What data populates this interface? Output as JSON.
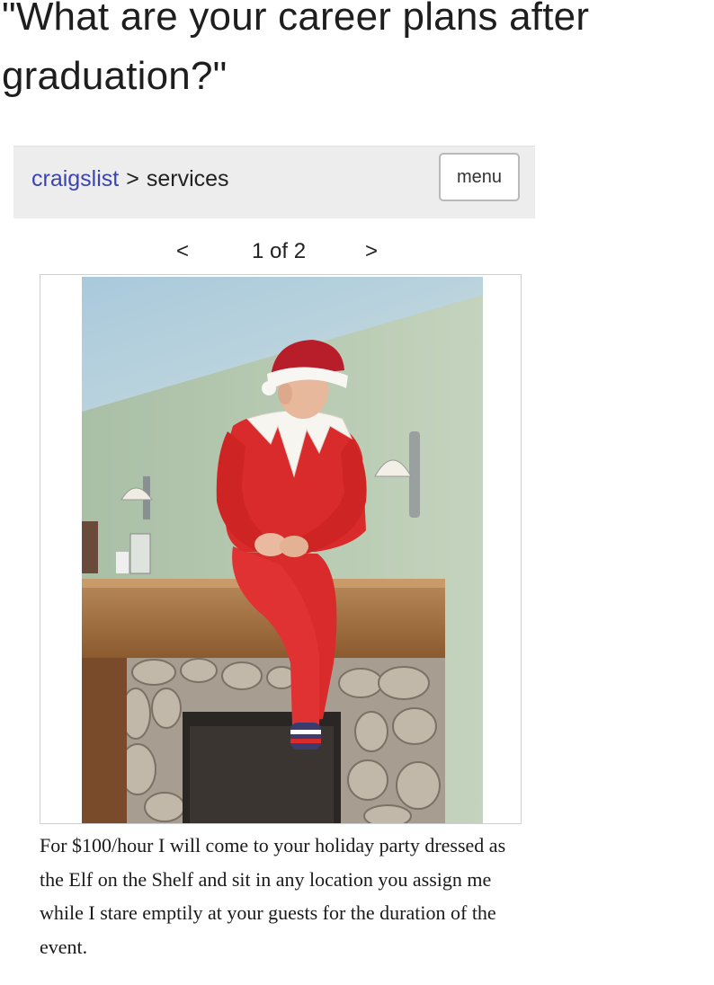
{
  "caption": "\"What are your career plans after graduation?\"",
  "header": {
    "site_link": "craigslist",
    "separator": ">",
    "category": "services",
    "menu_label": "menu"
  },
  "pager": {
    "prev_label": "<",
    "count_label": "1 of 2",
    "next_label": ">"
  },
  "listing": {
    "description": "For $100/hour I will come to your holiday party dressed as the Elf on the Shelf and sit in any location you assign me while I stare emptily at your guests for the duration of the event."
  },
  "colors": {
    "link": "#3b44b3",
    "header_bg": "#ededed",
    "elf_suit": "#d92b2b",
    "wall": "#b8ccb0",
    "mantel": "#9a6a3e",
    "stone": "#b0a59a"
  }
}
